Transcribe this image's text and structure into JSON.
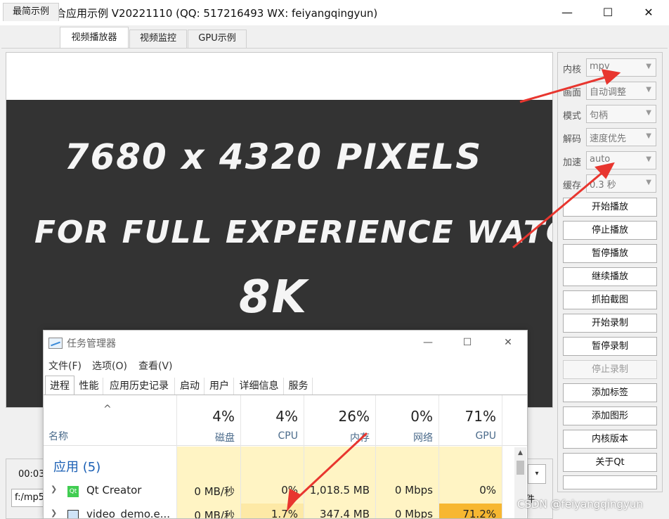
{
  "window": {
    "title": "视频综合应用示例 V20221110 (QQ: 517216493 WX: feiyangqingyun)",
    "minimize": "—",
    "maximize": "☐",
    "close": "✕"
  },
  "tabs": [
    "最简示例",
    "视频播放器",
    "视频监控",
    "GPU示例"
  ],
  "active_tab": "视频播放器",
  "video": {
    "line1": "7680 x 4320 PIXELS",
    "line2": "FOR FULL EXPERIENCE WATCH IN",
    "line3": "8K"
  },
  "bottom": {
    "time": "00:03",
    "path": "f:/mp5",
    "cut_button": "件"
  },
  "settings": [
    {
      "label": "内核",
      "value": "mpv"
    },
    {
      "label": "画面",
      "value": "自动调整"
    },
    {
      "label": "模式",
      "value": "句柄"
    },
    {
      "label": "解码",
      "value": "速度优先"
    },
    {
      "label": "加速",
      "value": "auto"
    },
    {
      "label": "缓存",
      "value": "0.3 秒"
    }
  ],
  "buttons": [
    {
      "label": "开始播放",
      "enabled": true
    },
    {
      "label": "停止播放",
      "enabled": true
    },
    {
      "label": "暂停播放",
      "enabled": true
    },
    {
      "label": "继续播放",
      "enabled": true
    },
    {
      "label": "抓拍截图",
      "enabled": true
    },
    {
      "label": "开始录制",
      "enabled": true
    },
    {
      "label": "暂停录制",
      "enabled": true
    },
    {
      "label": "停止录制",
      "enabled": false
    },
    {
      "label": "添加标签",
      "enabled": true
    },
    {
      "label": "添加图形",
      "enabled": true
    },
    {
      "label": "内核版本",
      "enabled": true
    },
    {
      "label": "关于Qt",
      "enabled": true
    }
  ],
  "task_manager": {
    "title": "任务管理器",
    "menu": [
      "文件(F)",
      "选项(O)",
      "查看(V)"
    ],
    "tabs": [
      "进程",
      "性能",
      "应用历史记录",
      "启动",
      "用户",
      "详细信息",
      "服务"
    ],
    "name_header": "名称",
    "columns": [
      {
        "name": "磁盘",
        "pct": "4%"
      },
      {
        "name": "CPU",
        "pct": "4%"
      },
      {
        "name": "内存",
        "pct": "26%"
      },
      {
        "name": "网络",
        "pct": "0%"
      },
      {
        "name": "GPU",
        "pct": "71%"
      }
    ],
    "section": "应用 (5)",
    "rows": [
      {
        "name": "Qt Creator",
        "disk": "0 MB/秒",
        "cpu": "0%",
        "mem": "1,018.5 MB",
        "net": "0 Mbps",
        "gpu": "0%"
      },
      {
        "name": "video_demo.e...",
        "disk": "0 MB/秒",
        "cpu": "1.7%",
        "mem": "347.4 MB",
        "net": "0 Mbps",
        "gpu": "71.2%"
      }
    ]
  },
  "watermark": "CSDN @feiyangqingyun",
  "colors": {
    "arrow": "#e8362f",
    "heat_light": "#fff4c4",
    "heat_gpu": "#f7b731",
    "accent_blue": "#1a5fb4"
  }
}
